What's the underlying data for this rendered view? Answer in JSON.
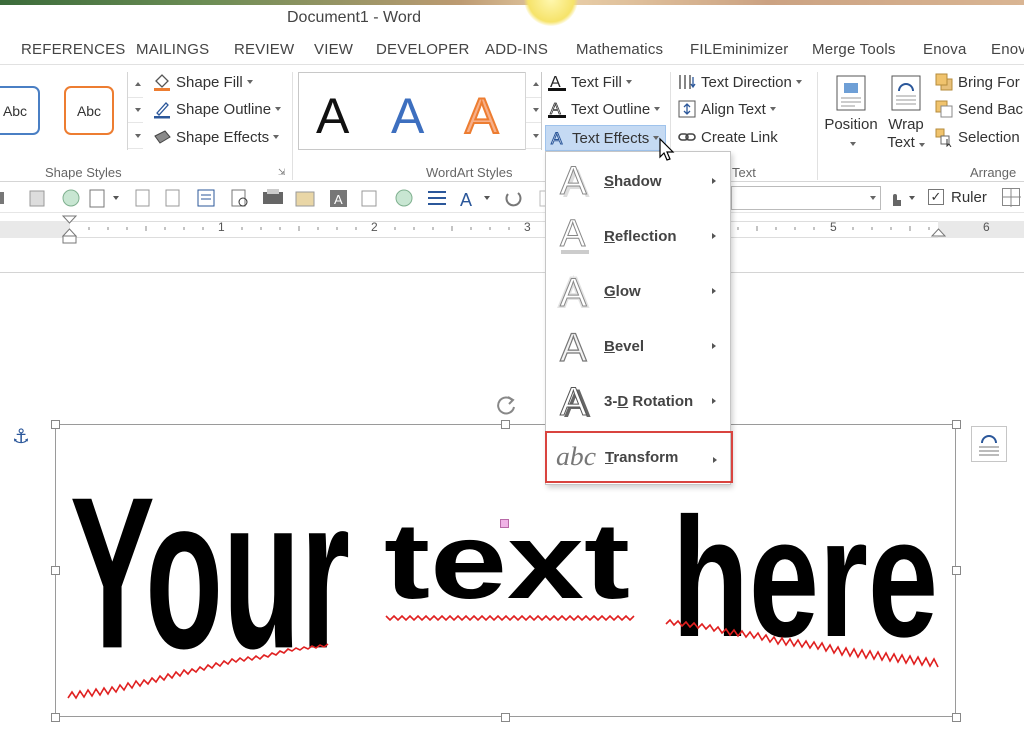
{
  "window": {
    "title": "Document1 - Word"
  },
  "tabs": [
    "REFERENCES",
    "MAILINGS",
    "REVIEW",
    "VIEW",
    "DEVELOPER",
    "ADD-INS",
    "Mathematics",
    "FILEminimizer",
    "Merge Tools",
    "Enova",
    "Enov"
  ],
  "shape_styles": {
    "swatch1": "Abc",
    "swatch2": "Abc",
    "shape_fill": "Shape Fill",
    "shape_outline": "Shape Outline",
    "shape_effects": "Shape Effects",
    "group_label": "Shape Styles"
  },
  "wordart_styles": {
    "samples": [
      "A",
      "A",
      "A"
    ],
    "text_fill": "Text Fill",
    "text_outline": "Text Outline",
    "text_effects": "Text Effects",
    "group_label": "WordArt Styles"
  },
  "text_group": {
    "text_direction": "Text Direction",
    "align_text": "Align Text",
    "create_link": "Create Link",
    "group_label": "Text"
  },
  "arrange_group": {
    "position": "Position",
    "wrap_text_1": "Wrap",
    "wrap_text_2": "Text",
    "bring_forward": "Bring For",
    "send_backward": "Send Back",
    "selection_pane": "Selection",
    "group_label": "Arrange"
  },
  "toolbar2": {
    "ruler_label": "Ruler",
    "ruler_checked": true
  },
  "ruler_numbers": [
    "1",
    "2",
    "3",
    "5",
    "6"
  ],
  "text_effects_menu": {
    "items": [
      {
        "pre": "",
        "key": "S",
        "post": "hadow"
      },
      {
        "pre": "",
        "key": "R",
        "post": "eflection"
      },
      {
        "pre": "",
        "key": "G",
        "post": "low"
      },
      {
        "pre": "",
        "key": "B",
        "post": "evel"
      },
      {
        "pre": "3-",
        "key": "D",
        "post": " Rotation"
      },
      {
        "pre": "",
        "key": "T",
        "post": "ransform"
      }
    ],
    "transform_icon_text": "abc"
  },
  "wordart_document": {
    "words": [
      "Your",
      "text",
      "here"
    ]
  },
  "colors": {
    "accent_blue": "#2b579a",
    "highlight_red": "#d9443f",
    "swatch_blue": "#4a7fc4",
    "swatch_orange": "#ed7d31",
    "squiggle_red": "#e02020"
  }
}
